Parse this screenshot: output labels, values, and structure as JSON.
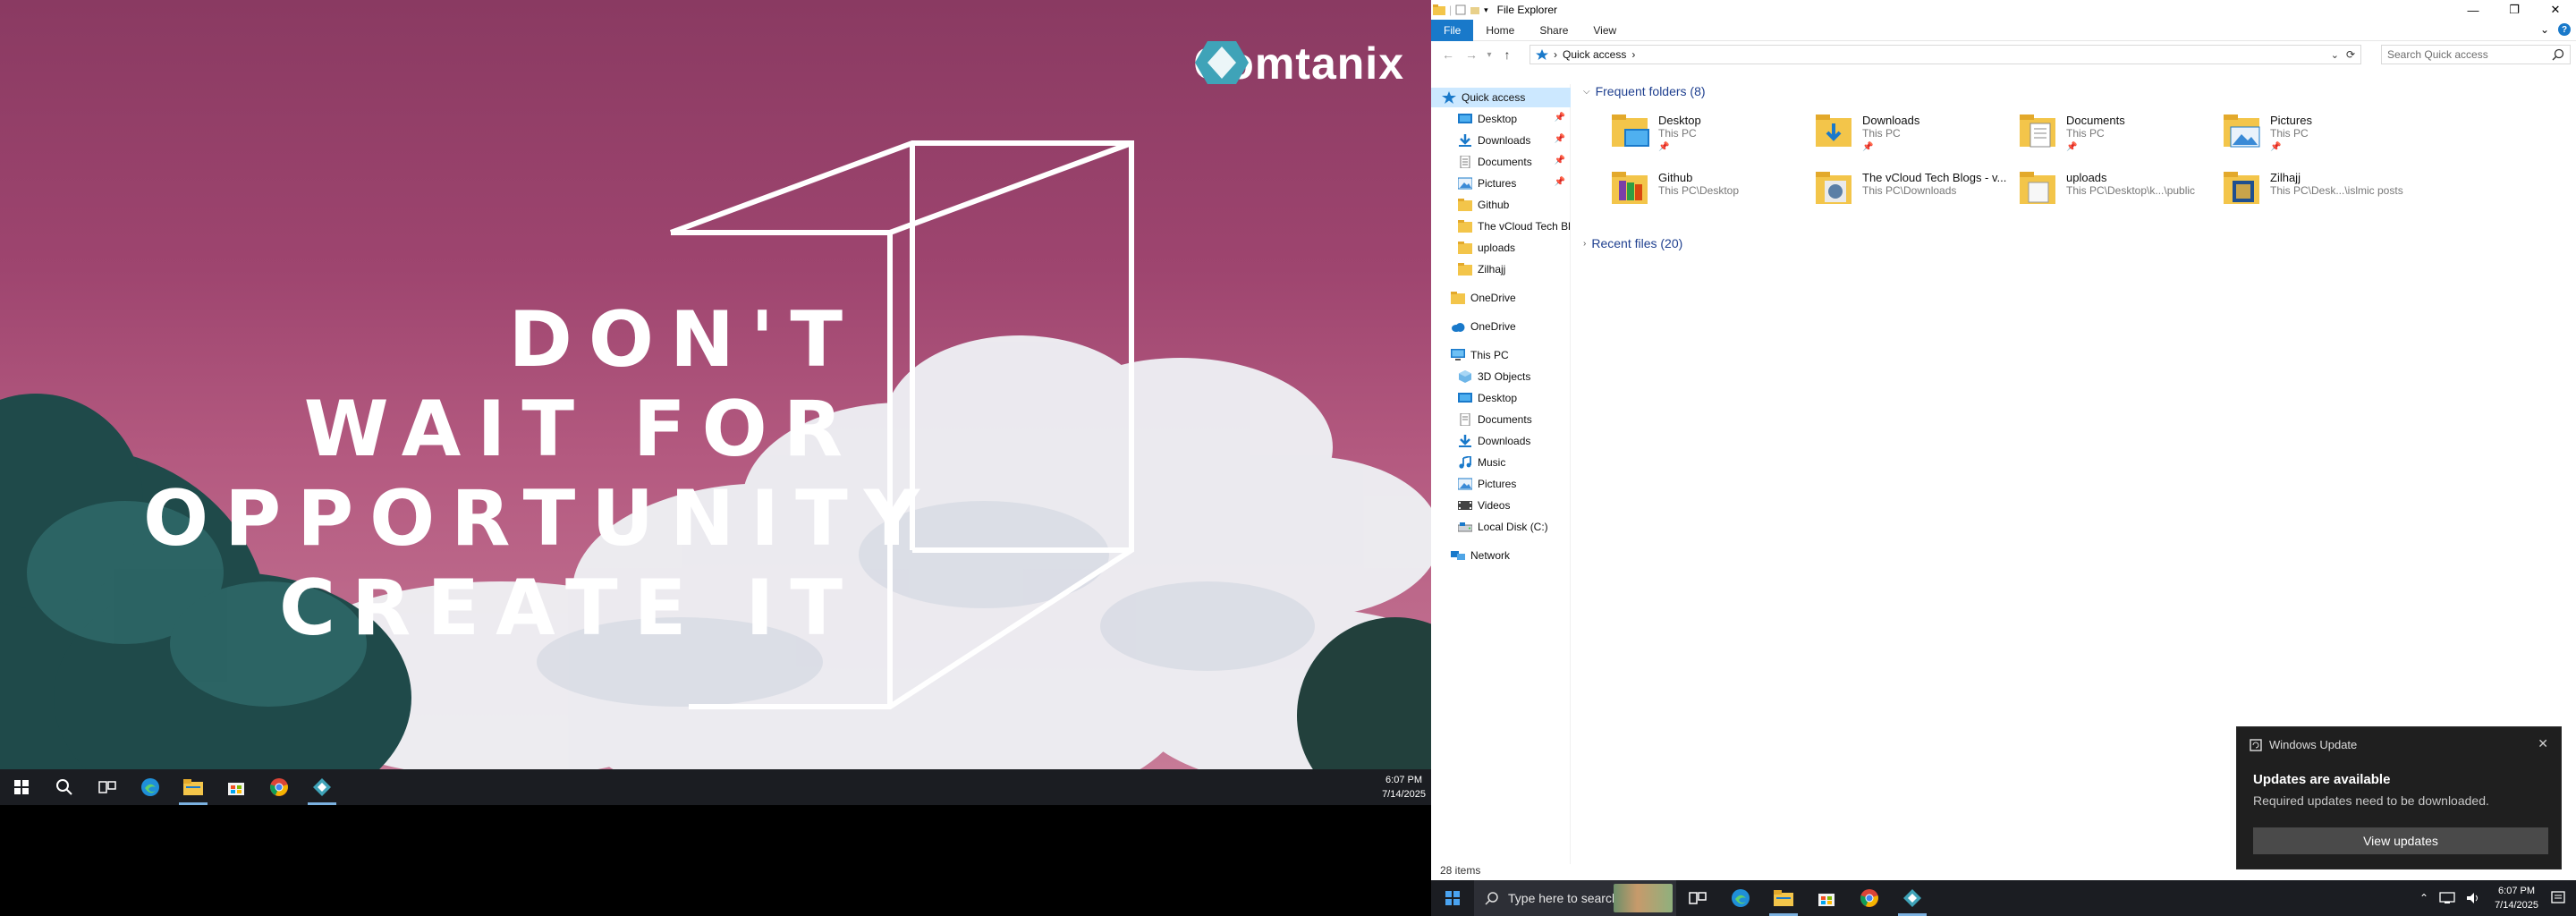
{
  "left_monitor": {
    "brand": "Comtanix",
    "slogan": [
      "DON'T",
      "WAIT FOR",
      "OPPORTUNITY",
      "CREATE IT"
    ],
    "clock": {
      "time": "6:07 PM",
      "date": "7/14/2025"
    }
  },
  "explorer": {
    "title": "File Explorer",
    "ribbon_tabs": [
      "File",
      "Home",
      "Share",
      "View"
    ],
    "address": {
      "location": "Quick access"
    },
    "search_placeholder": "Search Quick access",
    "nav_pane": {
      "quick_access": "Quick access",
      "pinned": [
        "Desktop",
        "Downloads",
        "Documents",
        "Pictures"
      ],
      "recent": [
        "Github",
        "The vCloud Tech Blo",
        "uploads",
        "Zilhajj"
      ],
      "onedrive_1": "OneDrive",
      "onedrive_2": "OneDrive",
      "this_pc": "This PC",
      "this_pc_items": [
        "3D Objects",
        "Desktop",
        "Documents",
        "Downloads",
        "Music",
        "Pictures",
        "Videos",
        "Local Disk (C:)"
      ],
      "network": "Network"
    },
    "frequent_header": "Frequent folders (8)",
    "recent_header": "Recent files (20)",
    "folders": [
      {
        "name": "Desktop",
        "location": "This PC",
        "pinned": true
      },
      {
        "name": "Downloads",
        "location": "This PC",
        "pinned": true
      },
      {
        "name": "Documents",
        "location": "This PC",
        "pinned": true
      },
      {
        "name": "Pictures",
        "location": "This PC",
        "pinned": true
      },
      {
        "name": "Github",
        "location": "This PC\\Desktop",
        "pinned": false
      },
      {
        "name": "The vCloud Tech Blogs - v...",
        "location": "This PC\\Downloads",
        "pinned": false
      },
      {
        "name": "uploads",
        "location": "This PC\\Desktop\\k...\\public",
        "pinned": false
      },
      {
        "name": "Zilhajj",
        "location": "This PC\\Desk...\\islmic posts",
        "pinned": false
      }
    ],
    "status": "28 items"
  },
  "toast": {
    "app": "Windows Update",
    "title": "Updates are available",
    "message": "Required updates need to be downloaded.",
    "button": "View updates"
  },
  "right_taskbar": {
    "search_placeholder": "Type here to search",
    "clock": {
      "time": "6:07 PM",
      "date": "7/14/2025"
    }
  },
  "colors": {
    "accent": "#1979ca",
    "wallpaper": "#9e456f",
    "taskbar": "#1b1d22",
    "folder": "#f3c54a"
  }
}
